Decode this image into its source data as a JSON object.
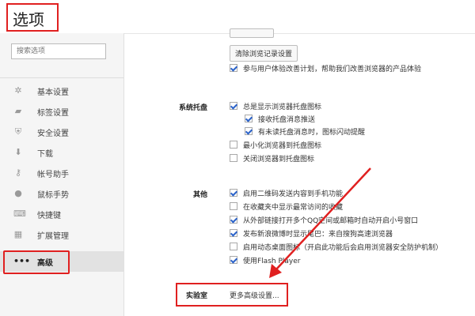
{
  "header": {
    "title": "选项"
  },
  "sidebar": {
    "search_placeholder": "搜索选项",
    "items": [
      {
        "label": "基本设置",
        "icon": "gear-icon"
      },
      {
        "label": "标签设置",
        "icon": "tabs-icon"
      },
      {
        "label": "安全设置",
        "icon": "shield-icon"
      },
      {
        "label": "下载",
        "icon": "download-icon"
      },
      {
        "label": "帐号助手",
        "icon": "key-icon"
      },
      {
        "label": "鼠标手势",
        "icon": "mouse-icon"
      },
      {
        "label": "快捷键",
        "icon": "keyboard-icon"
      },
      {
        "label": "扩展管理",
        "icon": "puzzle-icon"
      },
      {
        "label": "高级",
        "icon": "more-icon",
        "active": true
      }
    ]
  },
  "content": {
    "privacy": {
      "clear_history_button": "清除浏览记录设置",
      "ux_plan": {
        "label": "参与用户体验改善计划，帮助我们改善浏览器的产品体验",
        "checked": true
      }
    },
    "tray": {
      "heading": "系统托盘",
      "options": [
        {
          "label": "总是显示浏览器托盘图标",
          "checked": true
        },
        {
          "label": "接收托盘消息推送",
          "checked": true
        },
        {
          "label": "有未读托盘消息时，图标闪动提醒",
          "checked": true
        },
        {
          "label": "最小化浏览器到托盘图标",
          "checked": false
        },
        {
          "label": "关闭浏览器到托盘图标",
          "checked": false
        }
      ]
    },
    "other": {
      "heading": "其他",
      "options": [
        {
          "label": "启用二维码发送内容到手机功能",
          "checked": true
        },
        {
          "label": "在收藏夹中显示最常访问的收藏",
          "checked": false
        },
        {
          "label": "从外部链接打开多个QQ空间或邮箱时自动开启小号窗口",
          "checked": true
        },
        {
          "label": "发布新浪微博时显示尾巴：来自搜狗高速浏览器",
          "checked": true
        },
        {
          "label": "启用动态桌面图标（开启此功能后会启用浏览器安全防护机制）",
          "checked": false
        },
        {
          "label": "使用Flash Player",
          "checked": true
        }
      ]
    },
    "lab": {
      "heading": "实验室",
      "link": "更多高级设置..."
    }
  },
  "annotation_color": "#e02020"
}
